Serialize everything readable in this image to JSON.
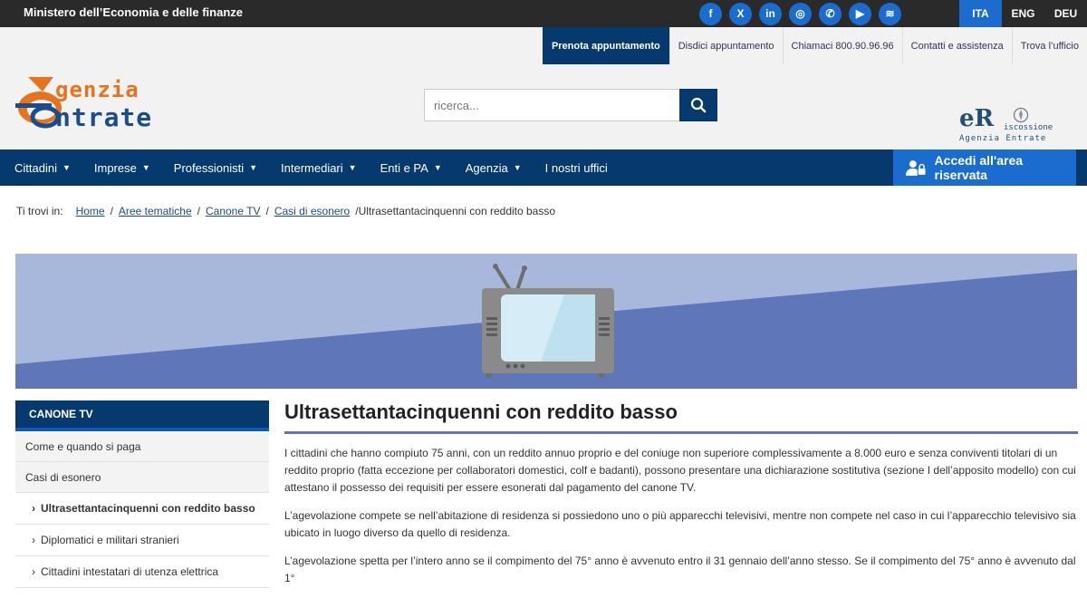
{
  "topbar": {
    "ministry": "Ministero dell’Economia e delle finanze",
    "social": [
      {
        "name": "facebook-icon",
        "glyph": "f"
      },
      {
        "name": "x-icon",
        "glyph": "X"
      },
      {
        "name": "linkedin-icon",
        "glyph": "in"
      },
      {
        "name": "instagram-icon",
        "glyph": "◎"
      },
      {
        "name": "whatsapp-icon",
        "glyph": "✆"
      },
      {
        "name": "youtube-icon",
        "glyph": "▶"
      },
      {
        "name": "rss-icon",
        "glyph": "≋"
      }
    ],
    "languages": [
      {
        "label": "ITA",
        "active": true
      },
      {
        "label": "ENG",
        "active": false
      },
      {
        "label": "DEU",
        "active": false
      }
    ]
  },
  "header": {
    "quick_links": [
      {
        "label": "Prenota appuntamento",
        "active": true
      },
      {
        "label": "Disdici appuntamento",
        "active": false
      },
      {
        "label": "Chiamaci 800.90.96.96",
        "active": false
      },
      {
        "label": "Contatti e assistenza",
        "active": false
      },
      {
        "label": "Trova l’ufficio",
        "active": false
      }
    ],
    "logo_line1": "genzia",
    "logo_line2": "ntrate",
    "search_placeholder": "ricerca...",
    "riscossione_er": "eR",
    "riscossione_line1": "iscossione",
    "riscossione_line2": "Agenzia Entrate"
  },
  "nav": {
    "items": [
      {
        "label": "Cittadini",
        "caret": true
      },
      {
        "label": "Imprese",
        "caret": true
      },
      {
        "label": "Professionisti",
        "caret": true
      },
      {
        "label": "Intermediari",
        "caret": true
      },
      {
        "label": "Enti e PA",
        "caret": true
      },
      {
        "label": "Agenzia",
        "caret": true
      },
      {
        "label": "I nostri uffici",
        "caret": false
      }
    ],
    "reserved_area": "Accedi all'area riservata"
  },
  "breadcrumb": {
    "prefix": "Ti trovi in:",
    "links": [
      "Home",
      "Aree tematiche",
      "Canone TV",
      "Casi di esonero"
    ],
    "current": "Ultrasettantacinquenni con reddito basso"
  },
  "sidebar": {
    "title": "CANONE TV",
    "items": [
      "Come e quando si paga",
      "Casi di esonero"
    ],
    "subitems": [
      {
        "label": "Ultrasettantacinquenni con reddito basso",
        "active": true
      },
      {
        "label": "Diplomatici e militari stranieri",
        "active": false
      },
      {
        "label": "Cittadini intestatari di utenza elettrica",
        "active": false
      }
    ]
  },
  "main": {
    "title": "Ultrasettantacinquenni con reddito basso",
    "paragraphs": [
      "I cittadini che hanno compiuto 75 anni, con un reddito annuo proprio e del coniuge non superiore complessivamente a 8.000 euro e senza conviventi titolari di un reddito proprio (fatta eccezione per collaboratori domestici, colf e badanti), possono presentare una dichiarazione sostitutiva (sezione I dell’apposito modello) con cui attestano il possesso dei requisiti per essere esonerati dal pagamento del canone TV.",
      "L’agevolazione compete se nell’abitazione di residenza si possiedono uno o più apparecchi televisivi, mentre non compete nel caso in cui l’apparecchio televisivo sia ubicato in luogo diverso da quello di residenza.",
      "L’agevolazione spetta per l’intero anno se il compimento del 75° anno è avvenuto entro il 31 gennaio dell’anno stesso. Se il compimento del 75° anno è avvenuto dal 1°"
    ]
  },
  "colors": {
    "navy": "#06396e",
    "blue": "#1a6ccf",
    "banner": "#5f76b9",
    "orange": "#e8731f"
  }
}
